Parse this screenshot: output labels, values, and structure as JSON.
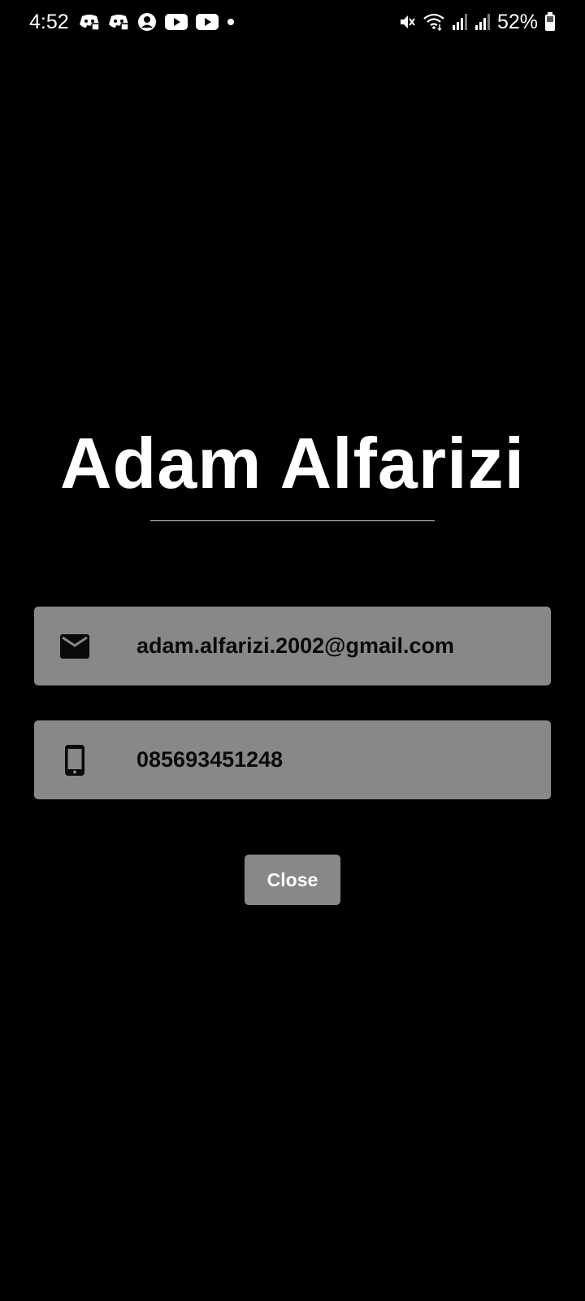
{
  "status_bar": {
    "time": "4:52",
    "battery_percent": "52%",
    "left_icons": [
      "discord-icon",
      "discord-icon",
      "account-circle-icon",
      "youtube-icon",
      "youtube-icon",
      "notification-dot-icon"
    ],
    "right_icons": [
      "mute-icon",
      "wifi-icon",
      "signal-icon",
      "signal-icon",
      "battery-icon"
    ]
  },
  "profile": {
    "name": "Adam Alfarizi",
    "email": "adam.alfarizi.2002@gmail.com",
    "phone": "085693451248"
  },
  "actions": {
    "close_label": "Close"
  },
  "colors": {
    "background": "#000000",
    "card": "#888888",
    "text_primary": "#ffffff",
    "card_text": "#0a0a0a"
  }
}
